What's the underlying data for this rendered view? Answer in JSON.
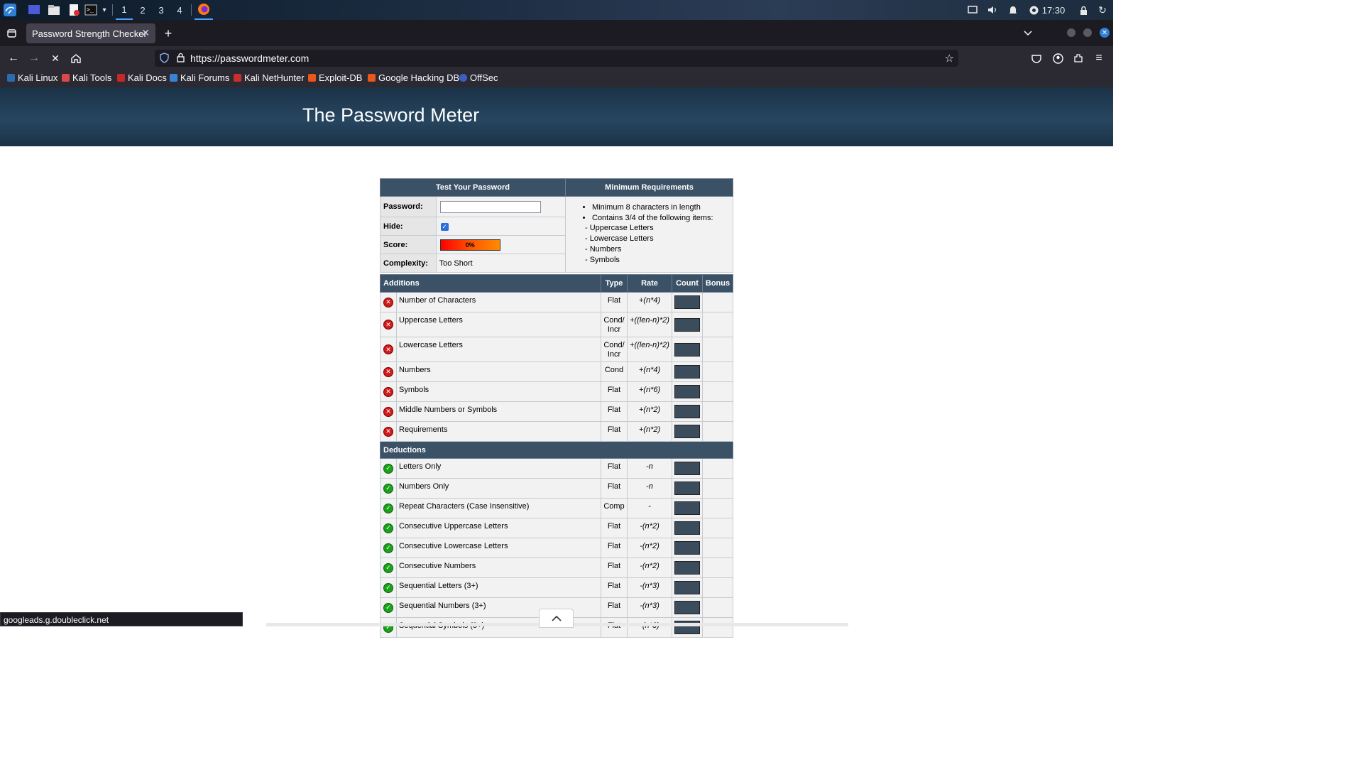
{
  "taskbar": {
    "workspaces": [
      "1",
      "2",
      "3",
      "4"
    ],
    "clock": "17:30"
  },
  "browser": {
    "tab_title": "Password Strength Checker",
    "url": "https://passwordmeter.com",
    "bookmarks": [
      "Kali Linux",
      "Kali Tools",
      "Kali Docs",
      "Kali Forums",
      "Kali NetHunter",
      "Exploit-DB",
      "Google Hacking DB",
      "OffSec"
    ]
  },
  "page": {
    "title": "The Password Meter"
  },
  "test_panel": {
    "header": "Test Your Password",
    "password_label": "Password:",
    "hide_label": "Hide:",
    "score_label": "Score:",
    "score_value": "0%",
    "complexity_label": "Complexity:",
    "complexity_value": "Too Short"
  },
  "requirements": {
    "header": "Minimum Requirements",
    "items": [
      "Minimum 8 characters in length",
      "Contains 3/4 of the following items:"
    ],
    "sub_items": [
      "- Uppercase Letters",
      "- Lowercase Letters",
      "- Numbers",
      "- Symbols"
    ]
  },
  "table_headers": {
    "additions": "Additions",
    "type": "Type",
    "rate": "Rate",
    "count": "Count",
    "bonus": "Bonus",
    "deductions": "Deductions"
  },
  "additions": [
    {
      "name": "Number of Characters",
      "type": "Flat",
      "rate": "+(n*4)",
      "status": "fail"
    },
    {
      "name": "Uppercase Letters",
      "type": "Cond/ Incr",
      "rate": "+((len-n)*2)",
      "status": "fail"
    },
    {
      "name": "Lowercase Letters",
      "type": "Cond/ Incr",
      "rate": "+((len-n)*2)",
      "status": "fail"
    },
    {
      "name": "Numbers",
      "type": "Cond",
      "rate": "+(n*4)",
      "status": "fail"
    },
    {
      "name": "Symbols",
      "type": "Flat",
      "rate": "+(n*6)",
      "status": "fail"
    },
    {
      "name": "Middle Numbers or Symbols",
      "type": "Flat",
      "rate": "+(n*2)",
      "status": "fail"
    },
    {
      "name": "Requirements",
      "type": "Flat",
      "rate": "+(n*2)",
      "status": "fail"
    }
  ],
  "deductions": [
    {
      "name": "Letters Only",
      "type": "Flat",
      "rate": "-n",
      "status": "pass"
    },
    {
      "name": "Numbers Only",
      "type": "Flat",
      "rate": "-n",
      "status": "pass"
    },
    {
      "name": "Repeat Characters (Case Insensitive)",
      "type": "Comp",
      "rate": "-",
      "status": "pass"
    },
    {
      "name": "Consecutive Uppercase Letters",
      "type": "Flat",
      "rate": "-(n*2)",
      "status": "pass"
    },
    {
      "name": "Consecutive Lowercase Letters",
      "type": "Flat",
      "rate": "-(n*2)",
      "status": "pass"
    },
    {
      "name": "Consecutive Numbers",
      "type": "Flat",
      "rate": "-(n*2)",
      "status": "pass"
    },
    {
      "name": "Sequential Letters (3+)",
      "type": "Flat",
      "rate": "-(n*3)",
      "status": "pass"
    },
    {
      "name": "Sequential Numbers (3+)",
      "type": "Flat",
      "rate": "-(n*3)",
      "status": "pass"
    },
    {
      "name": "Sequential Symbols (3+)",
      "type": "Flat",
      "rate": "-(n*3)",
      "status": "pass"
    }
  ],
  "status_bar": {
    "link": "googleads.g.doubleclick.net"
  },
  "colors": {
    "header_bg": "#3b5166",
    "fail": "#d11a1a",
    "pass": "#1aa31a"
  }
}
